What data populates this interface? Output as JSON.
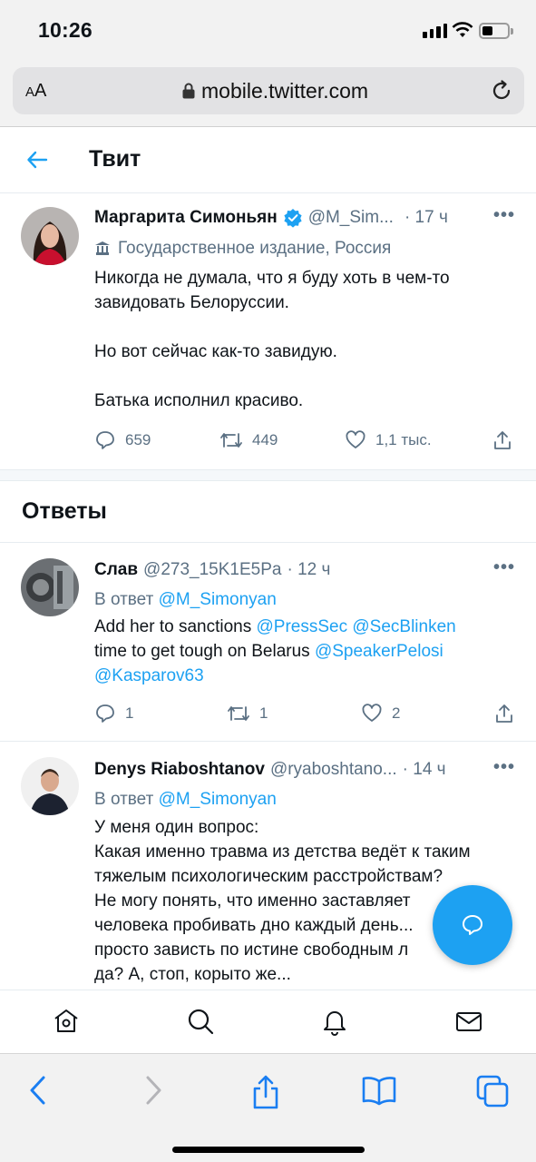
{
  "status_bar": {
    "time": "10:26"
  },
  "browser": {
    "text_size_label": "AA",
    "url": "mobile.twitter.com"
  },
  "header": {
    "title": "Твит"
  },
  "main_tweet": {
    "name": "Маргарита Симоньян",
    "handle": "@M_Sim...",
    "time": "· 17 ч",
    "label": "Государственное издание, Россия",
    "text": "Никогда не думала, что я буду хоть в чем-то\nзавидовать Белоруссии.\n\nНо вот сейчас как-то завидую.\n\nБатька исполнил красиво.",
    "replies": "659",
    "retweets": "449",
    "likes": "1,1 тыс."
  },
  "replies_section": {
    "title": "Ответы"
  },
  "replies": [
    {
      "name": "Слав",
      "handle": "@273_15K1E5Pa",
      "time": "· 12 ч",
      "reply_to_prefix": "В ответ",
      "reply_to": "@M_Simonyan",
      "text_1": "Add her to sanctions",
      "mention_1": "@PressSec",
      "mention_2": "@SecBlinken",
      "text_2": "time to get tough on Belarus",
      "mention_3": "@SpeakerPelosi",
      "mention_4": "@Kasparov63",
      "replies": "1",
      "retweets": "1",
      "likes": "2"
    },
    {
      "name": "Denys Riaboshtanov",
      "handle": "@ryaboshtano...",
      "time": "· 14 ч",
      "reply_to_prefix": "В ответ",
      "reply_to": "@M_Simonyan",
      "text": "У меня один вопрос:\nКакая именно травма из детства ведёт к таким\nтяжелым  психологическим расстройствам?\nНе могу понять, что именно заставляет\nчеловека пробивать дно каждый день...\nпросто зависть по истине свободным л\nда? А, стоп, корыто же..."
    }
  ],
  "colors": {
    "accent": "#1da1f2",
    "secondary_text": "#5b7083",
    "verified": "#1da1f2"
  },
  "icons": {
    "twitter_nav": [
      "home-icon",
      "search-icon",
      "notifications-icon",
      "messages-icon"
    ],
    "safari_toolbar": [
      "back-icon",
      "forward-icon",
      "share-icon",
      "bookmarks-icon",
      "tabs-icon"
    ]
  }
}
